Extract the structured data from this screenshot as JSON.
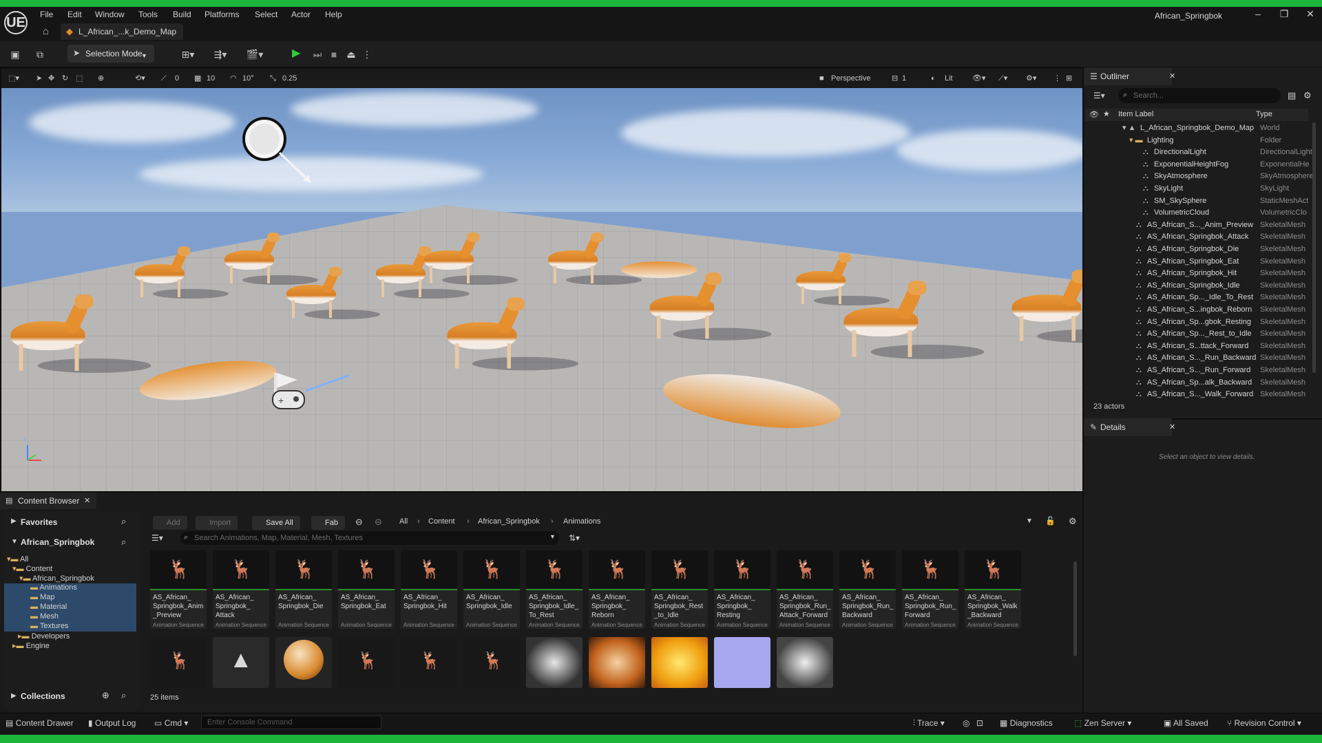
{
  "window": {
    "title": "African_Springbok",
    "logo": "UE",
    "map_tab": "L_African_...k_Demo_Map",
    "menu": [
      "File",
      "Edit",
      "Window",
      "Tools",
      "Build",
      "Platforms",
      "Select",
      "Actor",
      "Help"
    ],
    "controls": {
      "minimize": "–",
      "maximize": "❐",
      "close": "✕"
    }
  },
  "toolbar": {
    "selection_mode": "Selection Mode",
    "icons": [
      "save-icon",
      "source-control-icon",
      "add-actor-icon",
      "blueprint-icon",
      "cinematics-icon",
      "play-icon",
      "step-icon",
      "stop-icon",
      "eject-icon",
      "more-icon"
    ]
  },
  "viewport_toolbar": {
    "grid_snap": "10",
    "rotation_snap": "10°",
    "scale_snap": "0.25",
    "translate_snap": "0",
    "perspective": "Perspective",
    "view_count": "1",
    "lit": "Lit",
    "axis_z": "z"
  },
  "outliner": {
    "tab": "Outliner",
    "search_placeholder": "Search...",
    "col_label": "Item Label",
    "col_type": "Type",
    "count": "23 actors",
    "rows": [
      {
        "label": "L_African_Springbok_Demo_Map",
        "type": "World"
      },
      {
        "label": "Lighting",
        "type": "Folder"
      },
      {
        "label": "DirectionalLight",
        "type": "DirectionalLight"
      },
      {
        "label": "ExponentialHeightFog",
        "type": "ExponentialHe"
      },
      {
        "label": "SkyAtmosphere",
        "type": "SkyAtmosphere"
      },
      {
        "label": "SkyLight",
        "type": "SkyLight"
      },
      {
        "label": "SM_SkySphere",
        "type": "StaticMeshAct"
      },
      {
        "label": "VolumetricCloud",
        "type": "VolumetricClo"
      },
      {
        "label": "AS_African_S..._Anim_Preview",
        "type": "SkeletalMesh"
      },
      {
        "label": "AS_African_Springbok_Attack",
        "type": "SkeletalMesh"
      },
      {
        "label": "AS_African_Springbok_Die",
        "type": "SkeletalMesh"
      },
      {
        "label": "AS_African_Springbok_Eat",
        "type": "SkeletalMesh"
      },
      {
        "label": "AS_African_Springbok_Hit",
        "type": "SkeletalMesh"
      },
      {
        "label": "AS_African_Springbok_Idle",
        "type": "SkeletalMesh"
      },
      {
        "label": "AS_African_Sp..._Idle_To_Rest",
        "type": "SkeletalMesh"
      },
      {
        "label": "AS_African_S...ingbok_Reborn",
        "type": "SkeletalMesh"
      },
      {
        "label": "AS_African_Sp...gbok_Resting",
        "type": "SkeletalMesh"
      },
      {
        "label": "AS_African_Sp..._Rest_to_Idle",
        "type": "SkeletalMesh"
      },
      {
        "label": "AS_African_S...ttack_Forward",
        "type": "SkeletalMesh"
      },
      {
        "label": "AS_African_S..._Run_Backward",
        "type": "SkeletalMesh"
      },
      {
        "label": "AS_African_S..._Run_Forward",
        "type": "SkeletalMesh"
      },
      {
        "label": "AS_African_Sp...alk_Backward",
        "type": "SkeletalMesh"
      },
      {
        "label": "AS_African_S..._Walk_Forward",
        "type": "SkeletalMesh"
      }
    ]
  },
  "details": {
    "tab": "Details",
    "empty_message": "Select an object to view details."
  },
  "content_browser": {
    "tab": "Content Browser",
    "favorites": "Favorites",
    "project": "African_Springbok",
    "collections": "Collections",
    "tree": [
      "All",
      "Content",
      "African_Springbok",
      "Animations",
      "Map",
      "Material",
      "Mesh",
      "Textures",
      "Developers",
      "Engine"
    ],
    "buttons": {
      "add": "Add",
      "import": "Import",
      "save_all": "Save All",
      "fab": "Fab"
    },
    "breadcrumb": [
      "All",
      "Content",
      "African_Springbok",
      "Animations"
    ],
    "search_placeholder": "Search Animations, Map, Material, Mesh, Textures",
    "item_count": "25 items",
    "asset_type": "Animation Sequence",
    "assets": [
      "AS_African_\nSpringbok_Anim\n_Preview",
      "AS_African_\nSpringbok_\nAttack",
      "AS_African_\nSpringbok_Die",
      "AS_African_\nSpringbok_Eat",
      "AS_African_\nSpringbok_Hit",
      "AS_African_\nSpringbok_Idle",
      "AS_African_\nSpringbok_Idle_\nTo_Rest",
      "AS_African_\nSpringbok_\nReborn",
      "AS_African_\nSpringbok_Rest\n_to_Idle",
      "AS_African_\nSpringbok_\nResting",
      "AS_African_\nSpringbok_Run_\nAttack_Forward",
      "AS_African_\nSpringbok_Run_\nBackward",
      "AS_African_\nSpringbok_Run_\nForward",
      "AS_African_\nSpringbok_Walk\n_Backward"
    ]
  },
  "statusbar": {
    "content_drawer": "Content Drawer",
    "output_log": "Output Log",
    "cmd": "Cmd",
    "console_placeholder": "Enter Console Command",
    "trace": "Trace",
    "diagnostics": "Diagnostics",
    "zen_server": "Zen Server",
    "all_saved": "All Saved",
    "revision_control": "Revision Control"
  },
  "colors": {
    "accent_green": "#1db43a",
    "play_green": "#2fcc3a",
    "selection_blue": "#2d4a6a",
    "map_orange": "#e08a2a"
  }
}
